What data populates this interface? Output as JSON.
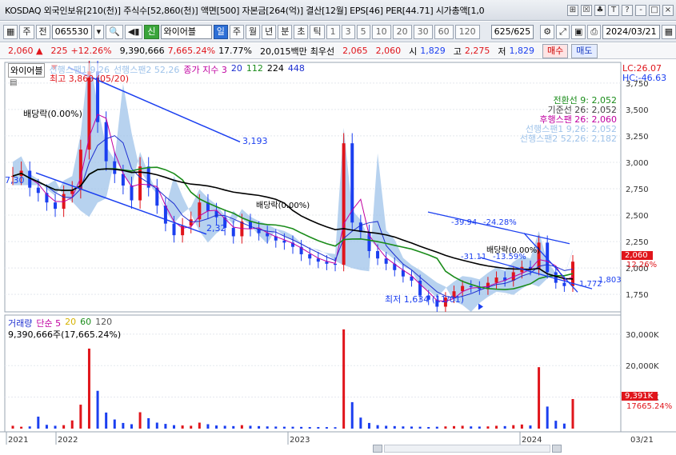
{
  "titlebar": {
    "title": "KOSDAQ 외국인보유[210(천)] 주식수[52,860(천)] 액면[500] 자본금[264(억)] 결산[12월] EPS[46] PER[44.71] 시가총액[1,0",
    "buttons": [
      "⊞",
      "☒",
      "♣",
      "T",
      "?",
      "-",
      "□",
      "×"
    ]
  },
  "toolbar": {
    "market_select": "주",
    "prev_label": "전",
    "code": "065530",
    "stock_badge": "신",
    "stock_name": "와이어블",
    "period_tabs": [
      "일",
      "주",
      "월",
      "년",
      "분",
      "초",
      "틱"
    ],
    "active_period": "일",
    "intervals": [
      "1",
      "3",
      "5",
      "10",
      "20",
      "30",
      "60",
      "120"
    ],
    "count_display": "625/625",
    "date": "2024/03/21"
  },
  "pricebar": {
    "price": "2,060",
    "change": "225",
    "change_pct": "+12.26%",
    "volume": "9,390,666",
    "volume_pct": "7,665.24%",
    "turnover": "17.77%",
    "amount": "20,015백만",
    "best_ask_label": "최우선",
    "best_ask": "2,065",
    "best_bid": "2,060",
    "open_label": "시",
    "open": "1,829",
    "high_label": "고",
    "high": "2,275",
    "low_label": "저",
    "low": "1,829",
    "buy_label": "매수",
    "sell_label": "매도"
  },
  "chart_data": {
    "type": "line",
    "title": "와이어블",
    "price_panel": {
      "legend": [
        "와이어블",
        "선행스팬1 9,26",
        "선행스팬2 52,26",
        "종가 지수 3",
        "20",
        "112",
        "224",
        "448"
      ],
      "legend_colors": [
        "#000000",
        "#9fc3ea",
        "#9fc3ea",
        "#c000a0",
        "#1d2fd0",
        "#1a8c1a",
        "#000000",
        "#7a7a7a"
      ],
      "yticks": [
        "3,750",
        "3,500",
        "3,250",
        "3,000",
        "2,750",
        "2,500",
        "2,250",
        "2,000",
        "1,750"
      ],
      "ylim": [
        1600,
        3900
      ],
      "ichimoku": [
        {
          "label": "전환선 9: 2,052",
          "color": "#1a8c1a"
        },
        {
          "label": "기준선 26: 2,052",
          "color": "#444444"
        },
        {
          "label": "후행스팬 26: 2,060",
          "color": "#c000a0"
        },
        {
          "label": "선행스팬1 9,26: 2,052",
          "color": "#9fc3ea"
        },
        {
          "label": "선행스팬2 52,26: 2,182",
          "color": "#9fc3ea"
        }
      ],
      "top_right": {
        "lc": "LC:26.07",
        "hc": "HC:-46.63"
      },
      "current_price_tag": "2,060",
      "current_pct_tag": "12.26%",
      "annotations": [
        {
          "text": "최고 3,860 (05/20)",
          "color": "red"
        },
        {
          "text": "최저 1,634 (11/01)",
          "color": "blue"
        },
        {
          "text": "배당락(0.00%)",
          "color": "black"
        },
        {
          "text": "배당락(0.00%)",
          "color": "black"
        },
        {
          "text": "배당락(0.00%)",
          "color": "black"
        },
        {
          "text": "3,193",
          "color": "blue"
        },
        {
          "text": "2,32",
          "color": "blue"
        },
        {
          "text": "7,30",
          "color": "blue"
        },
        {
          "text": "-39.94",
          "color": "blue"
        },
        {
          "text": "-24.28%",
          "color": "blue"
        },
        {
          "text": "-31.11",
          "color": "blue"
        },
        {
          "text": "-13.59%",
          "color": "blue"
        },
        {
          "text": "1,772",
          "color": "blue"
        },
        {
          "text": "1,803",
          "color": "blue"
        }
      ],
      "close_series": [
        2870,
        2920,
        2760,
        2710,
        2620,
        2560,
        2700,
        2740,
        3120,
        3860,
        3380,
        3010,
        2890,
        2780,
        2640,
        2960,
        2760,
        2590,
        2420,
        2310,
        2400,
        2460,
        2620,
        2540,
        2480,
        2380,
        2300,
        2440,
        2370,
        2330,
        2300,
        2260,
        2240,
        2200,
        2130,
        2090,
        2060,
        2040,
        2030,
        3180,
        2430,
        2340,
        2160,
        2090,
        2040,
        1980,
        1920,
        1880,
        1740,
        1700,
        1634,
        1720,
        1780,
        1830,
        1820,
        1800,
        1860,
        1910,
        1880,
        1960,
        2010,
        1990,
        2240,
        1960,
        1860,
        1829,
        2060
      ]
    },
    "volume_panel": {
      "legend": [
        "거래량",
        "단순 5",
        "20",
        "60",
        "120"
      ],
      "legend_colors": [
        "#1d2fd0",
        "#c000a0",
        "#d6b300",
        "#1a8c1a",
        "#555555"
      ],
      "yticks": [
        "30,000K",
        "20,000K",
        "10,000K"
      ],
      "ylim": [
        0,
        33000
      ],
      "current_volume_text": "9,390,666주(17,665.24%)",
      "current_volume_tag": "9,391K",
      "current_volume_pct_tag": "17665.24%",
      "volumes_k": [
        900,
        600,
        700,
        3800,
        1200,
        900,
        1100,
        2600,
        7600,
        25400,
        12000,
        5100,
        2900,
        1800,
        1400,
        5200,
        3300,
        1900,
        1500,
        1100,
        1000,
        900,
        1900,
        1400,
        1000,
        900,
        800,
        1100,
        900,
        800,
        700,
        650,
        600,
        600,
        550,
        500,
        500,
        480,
        450,
        31500,
        8400,
        3500,
        1800,
        1100,
        900,
        800,
        700,
        650,
        600,
        500,
        600,
        700,
        800,
        900,
        700,
        650,
        700,
        900,
        800,
        1100,
        1300,
        1000,
        19500,
        7000,
        2500,
        1600,
        9391
      ]
    },
    "x_axis": {
      "labels": [
        "2021",
        "2022",
        "2023",
        "2024",
        "03/21"
      ]
    }
  }
}
